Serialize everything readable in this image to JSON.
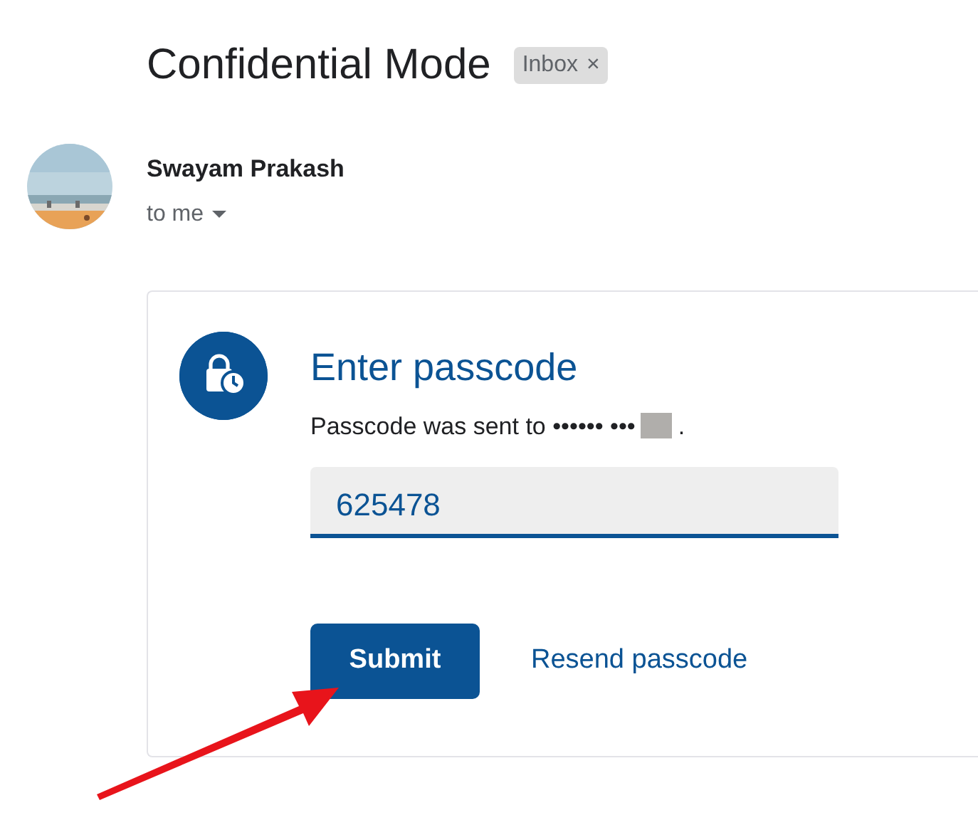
{
  "subject": {
    "title": "Confidential Mode",
    "label_chip": "Inbox",
    "chip_close": "×"
  },
  "sender": {
    "name": "Swayam Prakash",
    "recipient": "to me"
  },
  "passcode_card": {
    "heading": "Enter passcode",
    "message": "Passcode was sent to •••••• •••",
    "message_end": ".",
    "field_value": "625478",
    "buttons": [
      {
        "label": "Submit",
        "kind": "primary"
      },
      {
        "label": "Resend passcode",
        "kind": "link"
      }
    ]
  }
}
